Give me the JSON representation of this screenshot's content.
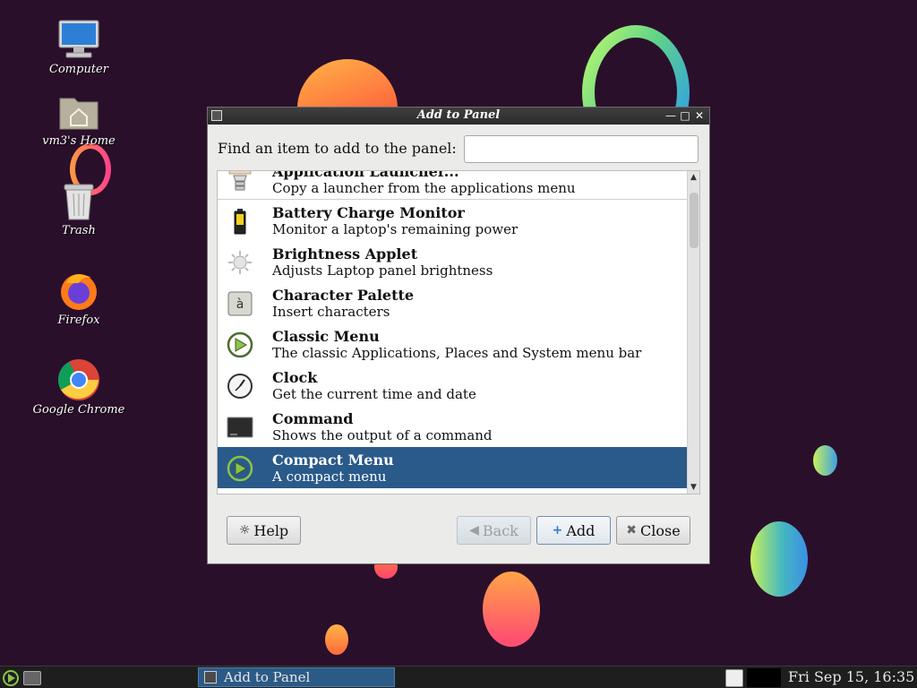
{
  "desktop": {
    "icons": [
      {
        "label": "Computer"
      },
      {
        "label": "vm3's Home"
      },
      {
        "label": "Trash"
      },
      {
        "label": "Firefox"
      },
      {
        "label": "Google Chrome"
      }
    ]
  },
  "dialog": {
    "title": "Add to Panel",
    "find_label": "Find an item to add to the panel:",
    "search_value": "",
    "items": [
      {
        "name": "Application Launcher...",
        "desc": "Copy a launcher from the applications menu",
        "icon": "launcher-icon"
      },
      {
        "name": "Battery Charge Monitor",
        "desc": "Monitor a laptop's remaining power",
        "icon": "battery-icon"
      },
      {
        "name": "Brightness Applet",
        "desc": "Adjusts Laptop panel brightness",
        "icon": "brightness-icon"
      },
      {
        "name": "Character Palette",
        "desc": "Insert characters",
        "icon": "character-palette-icon"
      },
      {
        "name": "Classic Menu",
        "desc": "The classic Applications, Places and System menu bar",
        "icon": "menu-icon"
      },
      {
        "name": "Clock",
        "desc": "Get the current time and date",
        "icon": "clock-icon"
      },
      {
        "name": "Command",
        "desc": "Shows the output of a command",
        "icon": "terminal-icon"
      },
      {
        "name": "Compact Menu",
        "desc": "A compact menu",
        "icon": "menu-icon",
        "selected": true
      }
    ],
    "buttons": {
      "help": "Help",
      "back": "Back",
      "add": "Add",
      "close": "Close"
    }
  },
  "taskbar": {
    "task_label": "Add to Panel",
    "clock": "Fri Sep 15, 16:35"
  },
  "colors": {
    "desktop_bg": "#2a0f2b",
    "selection": "#2a5a8a",
    "titlebar": "#2b2b2b"
  }
}
